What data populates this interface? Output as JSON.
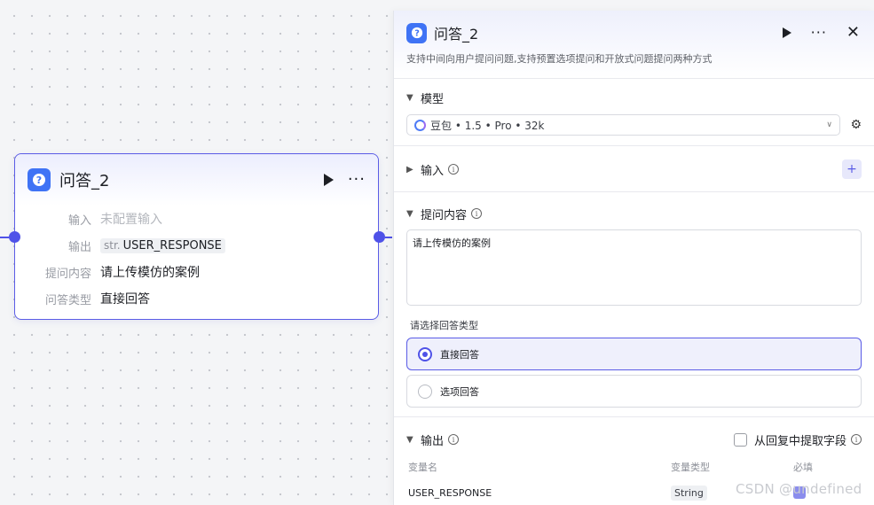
{
  "node": {
    "title": "问答_2",
    "rows": [
      {
        "label": "输入",
        "value": "未配置输入"
      },
      {
        "label": "输出",
        "type": "str.",
        "value": "USER_RESPONSE"
      },
      {
        "label": "提问内容",
        "value": "请上传模仿的案例"
      },
      {
        "label": "问答类型",
        "value": "直接回答"
      }
    ]
  },
  "panel": {
    "title": "问答_2",
    "description": "支持中间向用户提问问题,支持预置选项提问和开放式问题提问两种方式",
    "model": {
      "section_label": "模型",
      "selected": "豆包 • 1.5 • Pro • 32k"
    },
    "input": {
      "section_label": "输入"
    },
    "question": {
      "section_label": "提问内容",
      "content": "请上传模仿的案例",
      "answer_type_label": "请选择回答类型",
      "options": [
        "直接回答",
        "选项回答"
      ],
      "selected_option": "直接回答"
    },
    "output": {
      "section_label": "输出",
      "extract_label": "从回复中提取字段",
      "columns": [
        "变量名",
        "变量类型",
        "必填"
      ],
      "rows": [
        {
          "name": "USER_RESPONSE",
          "type": "String"
        }
      ]
    }
  },
  "watermark": "CSDN @undefined",
  "colors": {
    "accent": "#4f52e8",
    "icon_bg": "#3f73f5",
    "border": "#5a5ce6"
  }
}
